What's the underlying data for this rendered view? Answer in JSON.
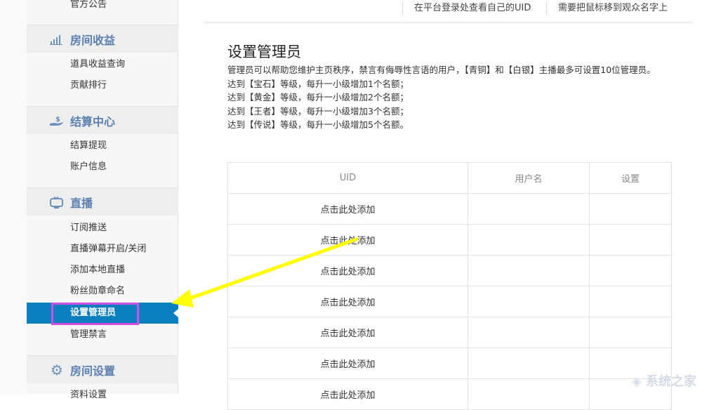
{
  "sidebar": {
    "top_item": "官方公告",
    "sections": [
      {
        "title": "房间收益",
        "icon": "bar-chart-icon",
        "items": [
          "道具收益查询",
          "贡献排行"
        ]
      },
      {
        "title": "结算中心",
        "icon": "money-hand-icon",
        "items": [
          "结算提现",
          "账户信息"
        ]
      },
      {
        "title": "直播",
        "icon": "tv-icon",
        "items": [
          "订阅推送",
          "直播弹幕开启/关闭",
          "添加本地直播",
          "粉丝勋章命名",
          "设置管理员",
          "管理禁言"
        ]
      },
      {
        "title": "房间设置",
        "icon": "gear-icon",
        "items": [
          "资料设置"
        ]
      }
    ]
  },
  "tips": [
    "在平台登录处查看自己的UID",
    "需要把鼠标移到观众名字上"
  ],
  "main": {
    "title": "设置管理员",
    "desc": [
      "管理员可以帮助您维护主页秩序，禁言有侮辱性言语的用户，【青铜】和【白银】主播最多可设置10位管理员。",
      "达到【宝石】等级，每升一小级增加1个名额；",
      "达到【黄金】等级，每升一小级增加2个名额；",
      "达到【王者】等级，每升一小级增加3个名额；",
      "达到【传说】等级，每升一小级增加5个名额。"
    ],
    "table": {
      "headers": [
        "UID",
        "用户名",
        "设置"
      ],
      "rows": [
        "点击此处添加",
        "点击此处添加",
        "点击此处添加",
        "点击此处添加",
        "点击此处添加",
        "点击此处添加",
        "点击此处添加"
      ]
    }
  },
  "watermark": "系统之家",
  "colors": {
    "accent": "#0a7fc0",
    "highlight": "#d04ee8",
    "arrow": "#ffff00",
    "section": "#5b7fae"
  }
}
